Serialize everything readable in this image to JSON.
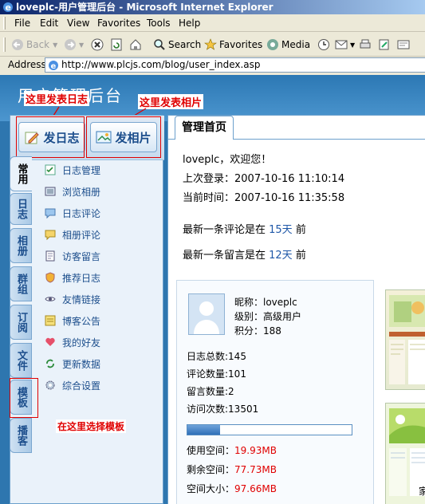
{
  "window": {
    "title": "loveplc-用户管理后台 - Microsoft Internet Explorer"
  },
  "menubar": [
    "File",
    "Edit",
    "View",
    "Favorites",
    "Tools",
    "Help"
  ],
  "toolbar": {
    "back": "Back",
    "search": "Search",
    "favorites": "Favorites",
    "media": "Media"
  },
  "address": {
    "label": "Address",
    "url": "http://www.plcjs.com/blog/user_index.asp"
  },
  "site": {
    "title": "用户管理后台"
  },
  "callouts": {
    "post_log": "这里发表日志",
    "post_photo": "这里发表相片",
    "choose_template": "在这里选择模板"
  },
  "buttons": {
    "post_log": "发日志",
    "post_photo": "发相片"
  },
  "vtabs": [
    "常用",
    "日志",
    "相册",
    "群组",
    "订阅",
    "文件",
    "模板",
    "播客"
  ],
  "menu": [
    "日志管理",
    "浏览相册",
    "日志评论",
    "相册评论",
    "访客留言",
    "推荐日志",
    "友情链接",
    "博客公告",
    "我的好友",
    "更新数据",
    "综合设置"
  ],
  "main": {
    "tab": "管理首页",
    "welcome": "loveplc，欢迎您！",
    "last_login_label": "上次登录：",
    "last_login": "2007-10-16 11:10:14",
    "current_time_label": "当前时间：",
    "current_time": "2007-10-16 11:35:58",
    "latest_comment_pre": "最新一条评论是在 ",
    "latest_comment_days": "15天",
    "latest_comment_post": " 前",
    "latest_message_pre": "最新一条留言是在 ",
    "latest_message_days": "12天",
    "latest_message_post": " 前"
  },
  "profile": {
    "nickname": "昵称：loveplc",
    "level": "级别：高级用户",
    "points": "积分：188",
    "logs": "日志总数:145",
    "comments": "评论数量:101",
    "messages": "留言数量:2",
    "visits": "访问次数:13501",
    "used_label": "使用空间：",
    "used": "19.93MB",
    "free_label": "剩余空间：",
    "free": "77.73MB",
    "total_label": "空间大小：",
    "total": "97.66MB",
    "usage_fraction": 0.2
  },
  "partial_text": "家"
}
